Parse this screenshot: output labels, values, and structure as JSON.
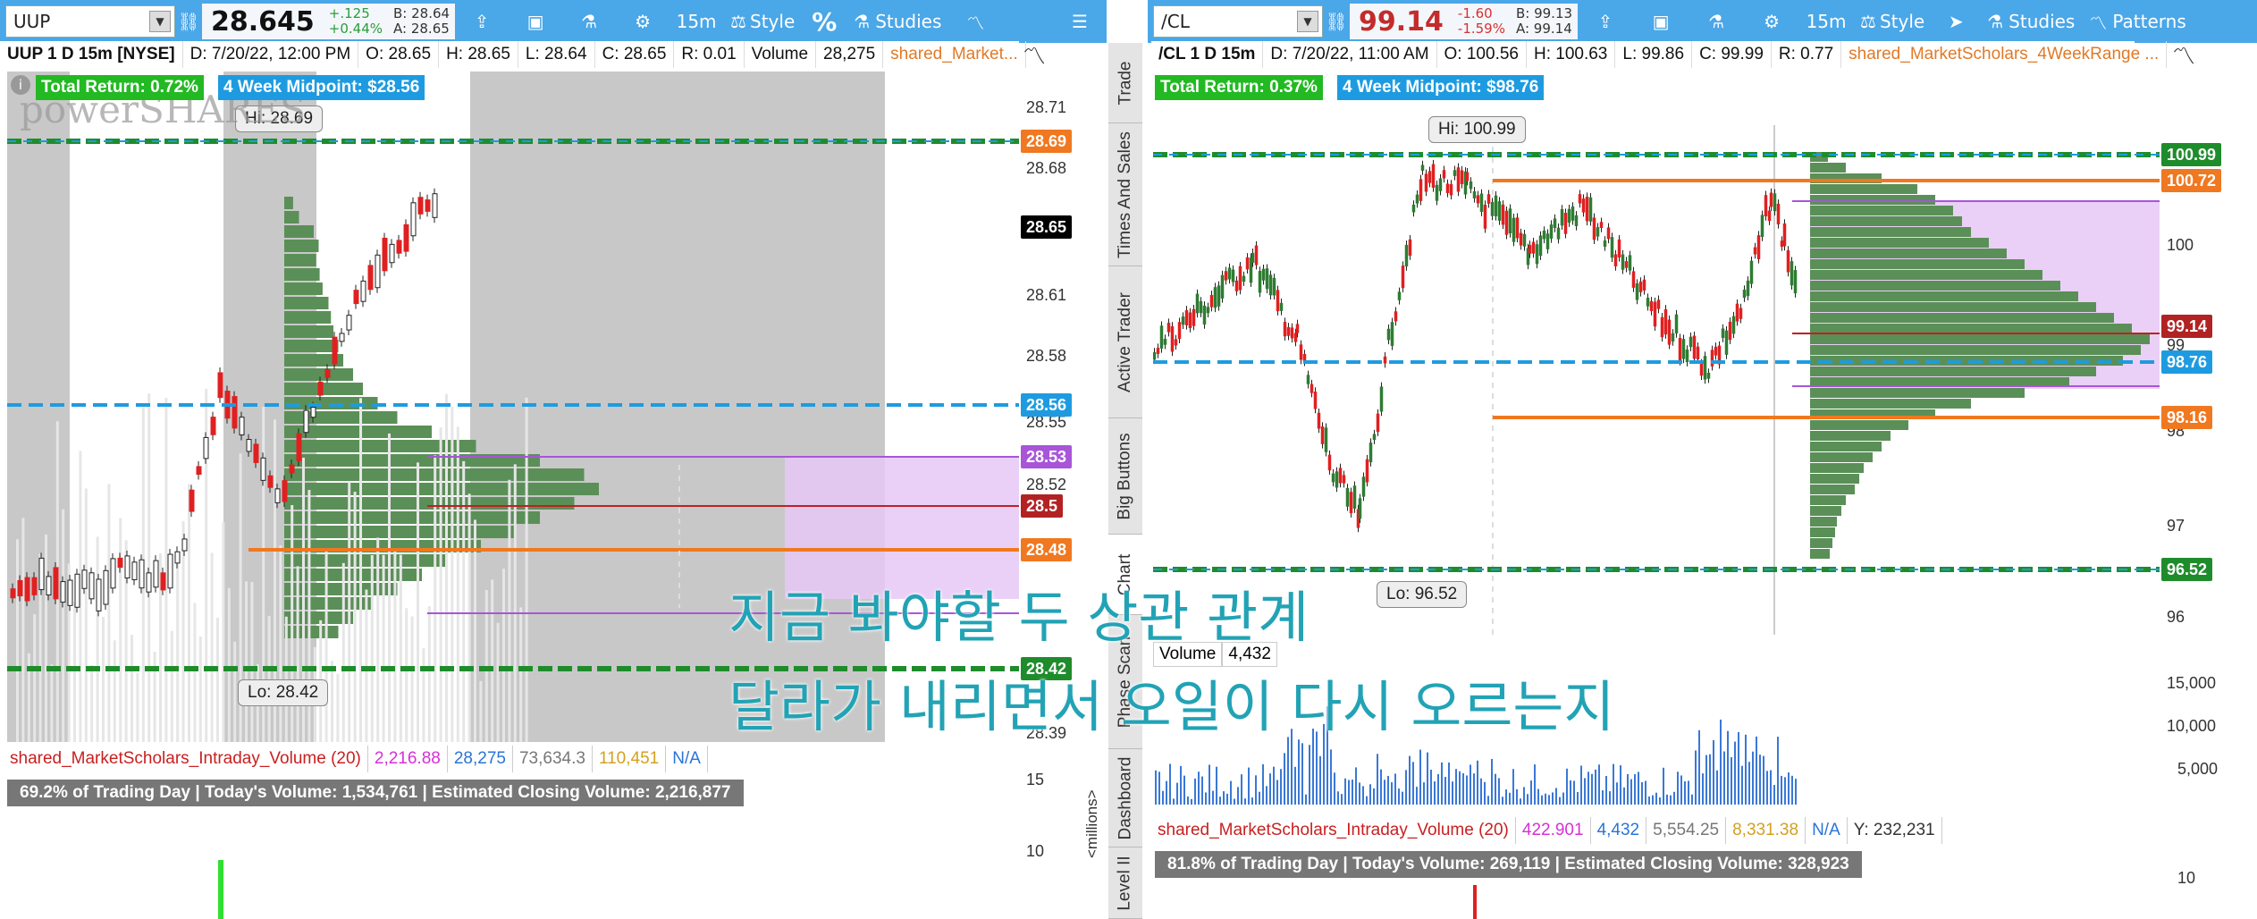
{
  "left": {
    "toolbar": {
      "symbol": "UUP",
      "price": "28.645",
      "change": "+.125",
      "change_pct": "+0.44%",
      "bid": "B: 28.64",
      "ask": "A: 28.65",
      "timeframe": "15m",
      "style_label": "Style",
      "percent_label": "%",
      "studies_label": "Studies"
    },
    "info": {
      "title": "UUP 1 D 15m [NYSE]",
      "date": "D: 7/20/22, 12:00 PM",
      "open": "O: 28.65",
      "high": "H: 28.65",
      "low": "L: 28.64",
      "close": "C: 28.65",
      "range": "R: 0.01",
      "volume_label": "Volume",
      "volume": "28,275",
      "study": "shared_Market..."
    },
    "badges": {
      "total_return": "Total Return: 0.72%",
      "midpoint": "4 Week Midpoint: $28.56"
    },
    "watermark": "powerSHARES",
    "callouts": {
      "hi": "Hi: 28.69",
      "lo": "Lo: 28.42"
    },
    "axis_ticks": [
      "28.71",
      "28.68",
      "28.61",
      "28.58",
      "28.55",
      "28.52",
      "28.39"
    ],
    "price_tags": {
      "t1": "28.69",
      "t2": "28.65",
      "t3": "28.56",
      "t4": "28.53",
      "t5": "28.5",
      "t6": "28.48",
      "t7": "28.42"
    },
    "volume_study": {
      "name": "shared_MarketScholars_Intraday_Volume (20)",
      "v1": "2,216.88",
      "v2": "28,275",
      "v3": "73,634.3",
      "v4": "110,451",
      "v5": "N/A"
    },
    "trading_day": "69.2% of Trading Day  | Today's Volume: 1,534,761 | Estimated Closing Volume: 2,216,877",
    "lower_ticks": [
      "15",
      "10"
    ],
    "lower_axis_label": "<millions>"
  },
  "right": {
    "toolbar": {
      "symbol": "/CL",
      "price": "99.14",
      "change": "-1.60",
      "change_pct": "-1.59%",
      "bid": "B: 99.13",
      "ask": "A: 99.14",
      "timeframe": "15m",
      "style_label": "Style",
      "studies_label": "Studies",
      "patterns_label": "Patterns"
    },
    "info": {
      "title": "/CL 1 D 15m",
      "date": "D: 7/20/22, 11:00 AM",
      "open": "O: 100.56",
      "high": "H: 100.63",
      "low": "L: 99.86",
      "close": "C: 99.99",
      "range": "R: 0.77",
      "study": "shared_MarketScholars_4WeekRange ..."
    },
    "badges": {
      "total_return": "Total Return: 0.37%",
      "midpoint": "4 Week Midpoint: $98.76"
    },
    "callouts": {
      "hi": "Hi: 100.99",
      "lo": "Lo: 96.52"
    },
    "axis_ticks": [
      "100",
      "99",
      "98",
      "97",
      "96"
    ],
    "price_tags": {
      "t1": "100.99",
      "t2": "100.72",
      "t3": "99.14",
      "t4": "98.76",
      "t5": "98.16",
      "t6": "96.52"
    },
    "volume_label": "Volume",
    "volume": "4,432",
    "volume_ticks": [
      "15,000",
      "10,000",
      "5,000"
    ],
    "volume_study": {
      "name": "shared_MarketScholars_Intraday_Volume (20)",
      "v1": "422.901",
      "v2": "4,432",
      "v3": "5,554.25",
      "v4": "8,331.38",
      "v5": "N/A",
      "v6": "Y: 232,231"
    },
    "trading_day": "81.8% of Trading Day  | Today's Volume: 269,119 | Estimated Closing Volume: 328,923",
    "lower_ticks": [
      "10"
    ]
  },
  "sidetabs": [
    "Trade",
    "Times And Sales",
    "Active Trader",
    "Big Buttons",
    "Chart",
    "Phase Scan",
    "Dashboard",
    "Level II"
  ],
  "overlay": {
    "line1": "지금 봐야할 두 상관 관계",
    "line2": "달라가 내리면서 오일이 다시 오르는지"
  },
  "colors": {
    "toolbar": "#4aa7e8",
    "up": "#2e7d32",
    "down": "#e02020",
    "profile": "#5b8f58",
    "orange": "#f07820",
    "midline": "#1e9be0",
    "overlay_text": "#22a3b5"
  }
}
